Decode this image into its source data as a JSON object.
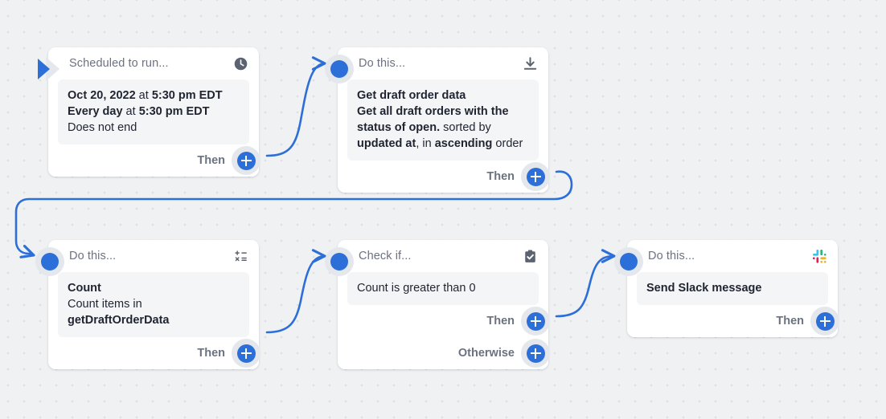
{
  "canvas": {
    "background_color": "#eff1f3",
    "dot_color": "#dcdfe3",
    "accent_color": "#2d6fd8",
    "connector_color": "#2d6fd8"
  },
  "nodes": [
    {
      "id": "trigger",
      "title": "Scheduled to run...",
      "icon": "clock-icon",
      "entry": "play-triangle",
      "body_lines": [
        [
          {
            "t": "Oct 20, 2022",
            "bold": true
          },
          {
            "t": " at ",
            "bold": false
          },
          {
            "t": "5:30 pm EDT",
            "bold": true
          }
        ],
        [
          {
            "t": "Every day",
            "bold": true
          },
          {
            "t": " at ",
            "bold": false
          },
          {
            "t": "5:30 pm EDT",
            "bold": true
          }
        ],
        [
          {
            "t": "Does not end",
            "bold": false
          }
        ]
      ],
      "footers": [
        {
          "label": "Then",
          "button": "add-step-button"
        }
      ]
    },
    {
      "id": "get-draft-order-data",
      "title": "Do this...",
      "icon": "download-icon",
      "entry": "dot",
      "body_lines": [
        [
          {
            "t": "Get draft order data",
            "bold": true
          }
        ],
        [
          {
            "t": "Get all draft orders with the",
            "bold": true
          }
        ],
        [
          {
            "t": "status of open.",
            "bold": true
          },
          {
            "t": " sorted by",
            "bold": false
          }
        ],
        [
          {
            "t": "updated at",
            "bold": true
          },
          {
            "t": ", in ",
            "bold": false
          },
          {
            "t": "ascending",
            "bold": true
          },
          {
            "t": " order",
            "bold": false
          }
        ]
      ],
      "footers": [
        {
          "label": "Then",
          "button": "add-step-button"
        }
      ]
    },
    {
      "id": "count",
      "title": "Do this...",
      "icon": "math-operations-icon",
      "entry": "dot",
      "body_lines": [
        [
          {
            "t": "Count",
            "bold": true
          }
        ],
        [
          {
            "t": "Count items in ",
            "bold": false
          },
          {
            "t": "getDraftOrderData",
            "bold": true
          }
        ]
      ],
      "footers": [
        {
          "label": "Then",
          "button": "add-step-button"
        }
      ]
    },
    {
      "id": "check-if",
      "title": "Check if...",
      "icon": "clipboard-check-icon",
      "entry": "dot",
      "body_lines": [
        [
          {
            "t": "Count is greater than 0",
            "bold": false
          }
        ]
      ],
      "footers": [
        {
          "label": "Then",
          "button": "add-step-button"
        },
        {
          "label": "Otherwise",
          "button": "add-otherwise-step-button"
        }
      ]
    },
    {
      "id": "send-slack-message",
      "title": "Do this...",
      "icon": "slack-icon",
      "entry": "dot",
      "body_lines": [
        [
          {
            "t": "Send Slack message",
            "bold": true
          }
        ]
      ],
      "footers": [
        {
          "label": "Then",
          "button": "add-step-button"
        }
      ]
    }
  ],
  "labels": {
    "trigger_title": "Scheduled to run...",
    "trigger_l1a": "Oct 20, 2022",
    "trigger_l1b": " at ",
    "trigger_l1c": "5:30 pm EDT",
    "trigger_l2a": "Every day",
    "trigger_l2b": " at ",
    "trigger_l2c": "5:30 pm EDT",
    "trigger_l3": "Does not end",
    "trigger_then": "Then",
    "get_title": "Do this...",
    "get_h": "Get draft order data",
    "get_l1": "Get all draft orders with the",
    "get_l2a": "status of open.",
    "get_l2b": " sorted by",
    "get_l3a": "updated at",
    "get_l3b": ", in ",
    "get_l3c": "ascending",
    "get_l3d": " order",
    "get_then": "Then",
    "count_title": "Do this...",
    "count_h": "Count",
    "count_l1a": "Count items in ",
    "count_l1b": "getDraftOrderData",
    "count_then": "Then",
    "check_title": "Check if...",
    "check_cond": "Count is greater than 0",
    "check_then": "Then",
    "check_otherwise": "Otherwise",
    "slack_title": "Do this...",
    "slack_h": "Send Slack message",
    "slack_then": "Then"
  },
  "slack_colors": {
    "green": "#2eb67d",
    "blue": "#36c5f0",
    "red": "#e01e5a",
    "yellow": "#ecb22e"
  }
}
